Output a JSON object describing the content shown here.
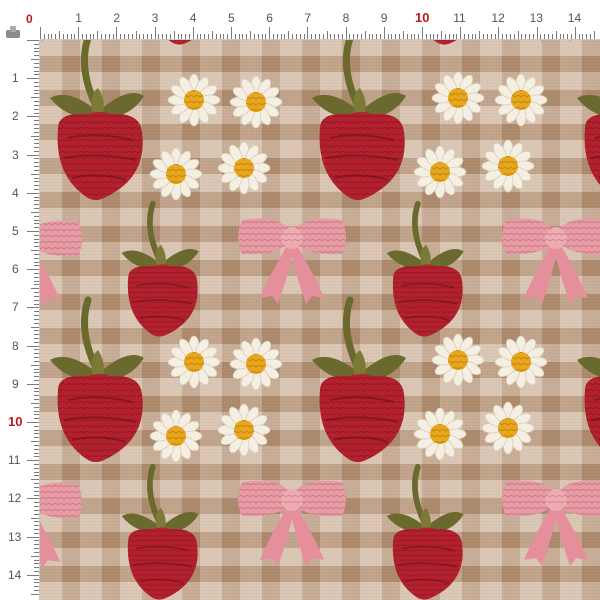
{
  "ruler": {
    "corner_label": "0",
    "top_numbers": [
      "1",
      "2",
      "3",
      "4",
      "5",
      "6",
      "7",
      "8",
      "9",
      "10",
      "11",
      "12",
      "13",
      "14"
    ],
    "left_numbers": [
      "1",
      "2",
      "3",
      "4",
      "5",
      "6",
      "7",
      "8",
      "9",
      "10",
      "11",
      "12",
      "13",
      "14"
    ],
    "highlight_number": "10",
    "highlight_color": "#c0181b"
  },
  "fabric": {
    "motifs": [
      "strawberry-large",
      "strawberry-small",
      "daisy",
      "pink-bow"
    ],
    "colors": {
      "linen": "#c9a88a",
      "strawberry": "#b3202e",
      "leaf": "#6b6a2e",
      "daisy_petal": "#f4efe2",
      "daisy_center": "#e7a61b",
      "bow": "#e99aa5"
    }
  }
}
